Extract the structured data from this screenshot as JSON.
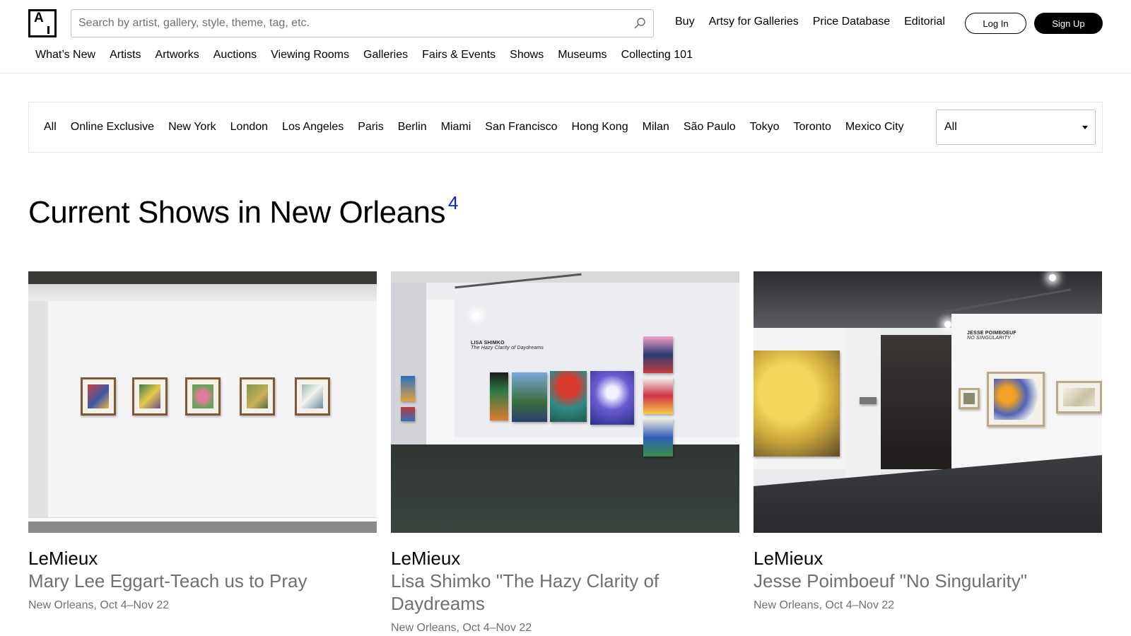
{
  "header": {
    "search_placeholder": "Search by artist, gallery, style, theme, tag, etc.",
    "top_links": [
      "Buy",
      "Artsy for Galleries",
      "Price Database",
      "Editorial"
    ],
    "login_label": "Log In",
    "signup_label": "Sign Up",
    "nav": [
      "What’s New",
      "Artists",
      "Artworks",
      "Auctions",
      "Viewing Rooms",
      "Galleries",
      "Fairs & Events",
      "Shows",
      "Museums",
      "Collecting 101"
    ]
  },
  "city_filter": {
    "tabs": [
      "All",
      "Online Exclusive",
      "New York",
      "London",
      "Los Angeles",
      "Paris",
      "Berlin",
      "Miami",
      "San Francisco",
      "Hong Kong",
      "Milan",
      "São Paulo",
      "Tokyo",
      "Toronto",
      "Mexico City"
    ],
    "select_value": "All"
  },
  "page": {
    "title": "Current Shows in New Orleans",
    "count": "4"
  },
  "shows": [
    {
      "gallery": "LeMieux",
      "title": "Mary Lee Eggart-Teach us to Pray",
      "meta": "New Orleans, Oct 4–Nov 22"
    },
    {
      "gallery": "LeMieux",
      "title": "Lisa Shimko \"The Hazy Clarity of Daydreams",
      "meta": "New Orleans, Oct 4–Nov 22",
      "wall_title": "LISA SHIMKO",
      "wall_subtitle": "The Hazy Clarity of Daydreams"
    },
    {
      "gallery": "LeMieux",
      "title": "Jesse Poimboeuf \"No Singularity\"",
      "meta": "New Orleans, Oct 4–Nov 22",
      "wall_title": "JESSE POIMBOEUF",
      "wall_subtitle": "NO SINGULARITY"
    }
  ],
  "icons": {
    "search": "search-icon",
    "caret": "caret-down-icon",
    "logo": "artsy-logo"
  },
  "colors": {
    "accent": "#1023d7",
    "muted": "#707070",
    "border": "#e5e5e5"
  }
}
